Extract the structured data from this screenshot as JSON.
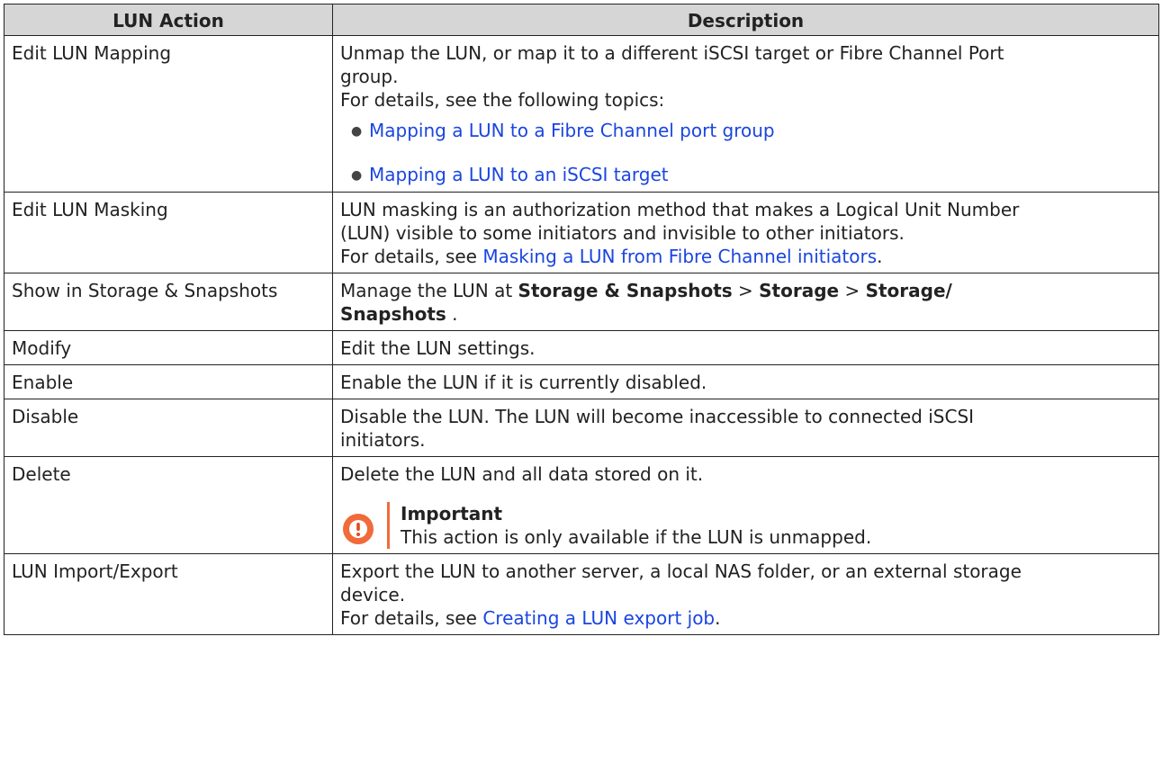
{
  "table": {
    "headers": [
      "LUN Action",
      "Description"
    ],
    "rows": {
      "edit_mapping": {
        "action": "Edit LUN Mapping",
        "line1": "Unmap the LUN, or map it to a different iSCSI target or Fibre Channel Port",
        "line2": "group.",
        "line3": "For details, see the following topics:",
        "links": [
          "Mapping a LUN to a Fibre Channel port group",
          "Mapping a LUN to an iSCSI target"
        ]
      },
      "edit_masking": {
        "action": "Edit LUN Masking",
        "line1": "LUN masking is an authorization method that makes a Logical Unit Number",
        "line2": "(LUN) visible to some initiators and invisible to other initiators.",
        "line3_prefix": "For details, see ",
        "line3_link": "Masking a LUN from Fibre Channel initiators",
        "line3_suffix": "."
      },
      "show_in_storage": {
        "action": "Show in Storage & Snapshots",
        "prefix": "Manage the LUN at ",
        "path1": "Storage & Snapshots",
        "sep1": " > ",
        "path2": "Storage",
        "sep2": " > ",
        "path3a": "Storage/",
        "path3b": "Snapshots",
        "suffix": " ."
      },
      "modify": {
        "action": "Modify",
        "description": "Edit the LUN settings."
      },
      "enable": {
        "action": "Enable",
        "description": "Enable the LUN if it is currently disabled."
      },
      "disable": {
        "action": "Disable",
        "line1": "Disable the LUN. The LUN will become inaccessible to connected iSCSI",
        "line2": "initiators."
      },
      "delete": {
        "action": "Delete",
        "description": "Delete the LUN and all data stored on it.",
        "note_title": "Important",
        "note_text": "This action is only available if the LUN is unmapped."
      },
      "import_export": {
        "action": "LUN Import/Export",
        "line1": "Export the LUN to another server, a local NAS folder, or an external storage",
        "line2": "device.",
        "line3_prefix": "For details, see ",
        "line3_link": "Creating a LUN export job",
        "line3_suffix": "."
      }
    }
  },
  "colors": {
    "link": "#1a45e0",
    "header_bg": "#d6d6d6",
    "important": "#f06a3a"
  },
  "icons": {
    "important": "exclamation-circle-icon",
    "bullet": "bullet-dot"
  }
}
